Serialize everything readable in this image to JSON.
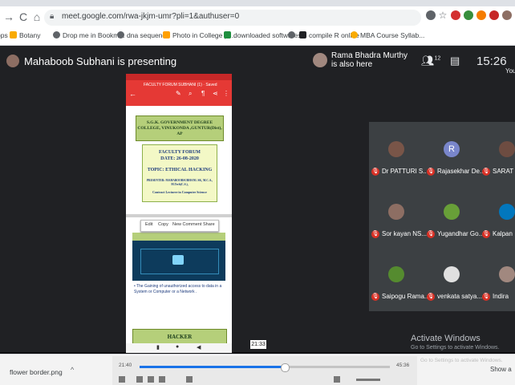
{
  "browser": {
    "url": "meet.google.com/rwa-jkjm-umr?pli=1&authuser=0",
    "bookmarks": [
      {
        "label": "Botany",
        "color": "#f9ab00"
      },
      {
        "label": "Drop me in Bookm...",
        "color": "#5f6368"
      },
      {
        "label": "dna sequence",
        "color": "#5f6368"
      },
      {
        "label": "Photo in College pi...",
        "color": "#ffa000"
      },
      {
        "label": "downloaded softwares",
        "color": "#1e8e3e"
      },
      {
        "label": "compile R online",
        "color": "#202124"
      },
      {
        "label": "MBA Course Syllab...",
        "color": "#f9ab00"
      }
    ]
  },
  "meet": {
    "presenter_text": "Mahaboob Subhani is presenting",
    "also_here_name": "Rama Bhadra Murthy Pen...",
    "also_here_sub": "is also here",
    "people_count": "12",
    "clock": "15:26",
    "you_label": "You"
  },
  "document": {
    "caption": "FACULTY FORUM SUBHANI (1) · Saved",
    "college": "S.G.K. GOVERNMENT DEGREE COLLEGE, VINUKONDA ,GUNTUR(Dist), AP",
    "forum": "FACULTY FORUM",
    "date": "DATE: 26-08-2020",
    "topic": "TOPIC: ETHICAL HACKING",
    "presenter": "PRESENTER: MAHABOOBSUBHANI. SK, M.C.A., M.Tech(C.S.),",
    "role": "Contract Lecturer in Computer Science",
    "menu": [
      "Edit",
      "Copy",
      "New Comment",
      "Share"
    ],
    "paragraph": "• The Gaining of unauthorized access to data in a System or Computer or a Network .",
    "hacker_title": "HACKER"
  },
  "participants": [
    {
      "name": "Dr PATTURI S...",
      "avatar": "photo",
      "color": "#795548"
    },
    {
      "name": "Rajasekhar De...",
      "avatar": "R",
      "color": "#7986cb"
    },
    {
      "name": "SARAT",
      "avatar": "photo",
      "color": "#6d4c41"
    },
    {
      "name": "Sor kayan NS...",
      "avatar": "photo",
      "color": "#8d6e63"
    },
    {
      "name": "Yugandhar Go...",
      "avatar": "photo",
      "color": "#689f38"
    },
    {
      "name": "Kalpan",
      "avatar": "photo",
      "color": "#0277bd"
    },
    {
      "name": "Saipogu Rama...",
      "avatar": "photo",
      "color": "#558b2f"
    },
    {
      "name": "venkata satya...",
      "avatar": "photo",
      "color": "#e0e0e0"
    },
    {
      "name": "Indira",
      "avatar": "photo",
      "color": "#a1887f"
    }
  ],
  "screen_badge": "21:33",
  "watermark": {
    "line1": "Activate Windows",
    "line2": "Go to Settings to activate Windows."
  },
  "downloads": {
    "file": "flower border.png",
    "show_all": "Show a"
  },
  "player": {
    "time_start": "21:40",
    "time_end": "45:36",
    "progress": 0.58
  }
}
